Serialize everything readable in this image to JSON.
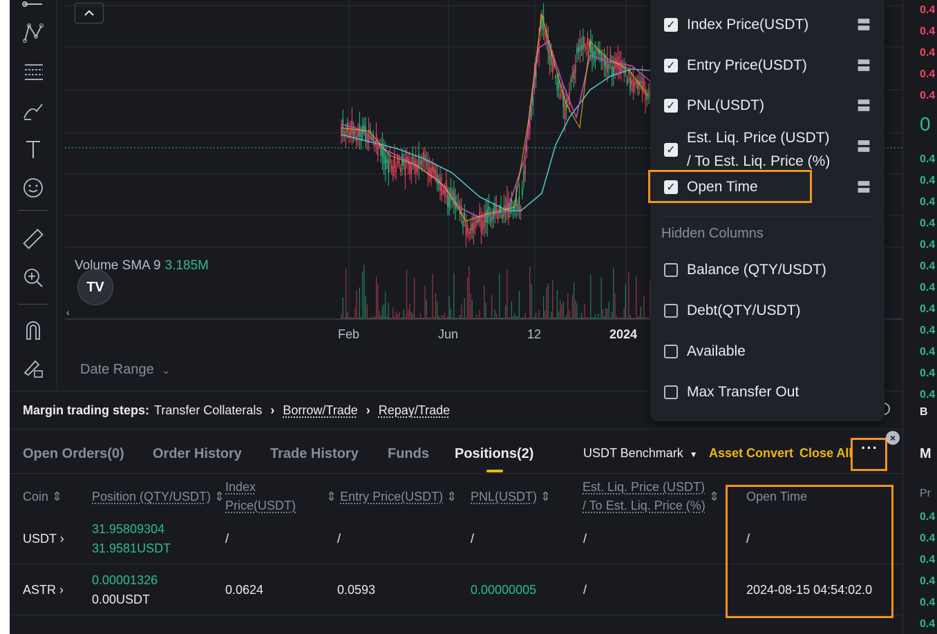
{
  "chart": {
    "volume_label": "Volume SMA 9",
    "volume_value": "3.185M",
    "logo_text": "TV",
    "x_labels": [
      "Feb",
      "Jun",
      "12",
      "2024"
    ],
    "date_range": "Date Range"
  },
  "steps": {
    "prefix": "Margin trading steps:",
    "step1": "Transfer Collaterals",
    "step2": "Borrow/Trade",
    "step3": "Repay/Trade"
  },
  "tabs": {
    "open_orders": "Open Orders(0)",
    "order_history": "Order History",
    "trade_history": "Trade History",
    "funds": "Funds",
    "positions": "Positions(2)"
  },
  "toolbar": {
    "benchmark": "USDT Benchmark",
    "asset_convert": "Asset Convert",
    "close_all": "Close All",
    "more": "···"
  },
  "table": {
    "headers": {
      "coin": "Coin",
      "position": "Position (QTY/USDT)",
      "index_price_1": "Index",
      "index_price_2": "Price(USDT)",
      "entry_price": "Entry Price(USDT)",
      "pnl": "PNL(USDT)",
      "liq_1": "Est. Liq. Price (USDT)",
      "liq_2": "/ To Est. Liq. Price (%)",
      "open_time": "Open Time"
    },
    "rows": [
      {
        "coin": "USDT",
        "pos_qty": "31.95809304",
        "pos_usdt": "31.9581USDT",
        "index": "/",
        "entry": "/",
        "pnl": "/",
        "liq": "/",
        "open_time": "/"
      },
      {
        "coin": "ASTR",
        "pos_qty": "0.00001326",
        "pos_usdt": "0.00USDT",
        "index": "0.0624",
        "entry": "0.0593",
        "pnl": "0.00000005",
        "liq": "/",
        "open_time": "2024-08-15 04:54:02.0"
      }
    ]
  },
  "dropdown": {
    "visible_columns": [
      "Index Price(USDT)",
      "Entry Price(USDT)",
      "PNL(USDT)",
      "Est. Liq. Price (USDT)",
      "/ To Est. Liq. Price (%)",
      "Open Time"
    ],
    "hidden_title": "Hidden Columns",
    "hidden_columns": [
      "Balance (QTY/USDT)",
      "Debt(QTY/USDT)",
      "Available",
      "Max Transfer Out"
    ]
  },
  "orderbook": {
    "big_value": "0",
    "label_b": "B",
    "label_m": "M",
    "label_pr": "Pr"
  },
  "colors": {
    "accent": "#f0b90b",
    "highlight": "#f7931a",
    "up": "#2ebd85",
    "down": "#f6465d"
  }
}
